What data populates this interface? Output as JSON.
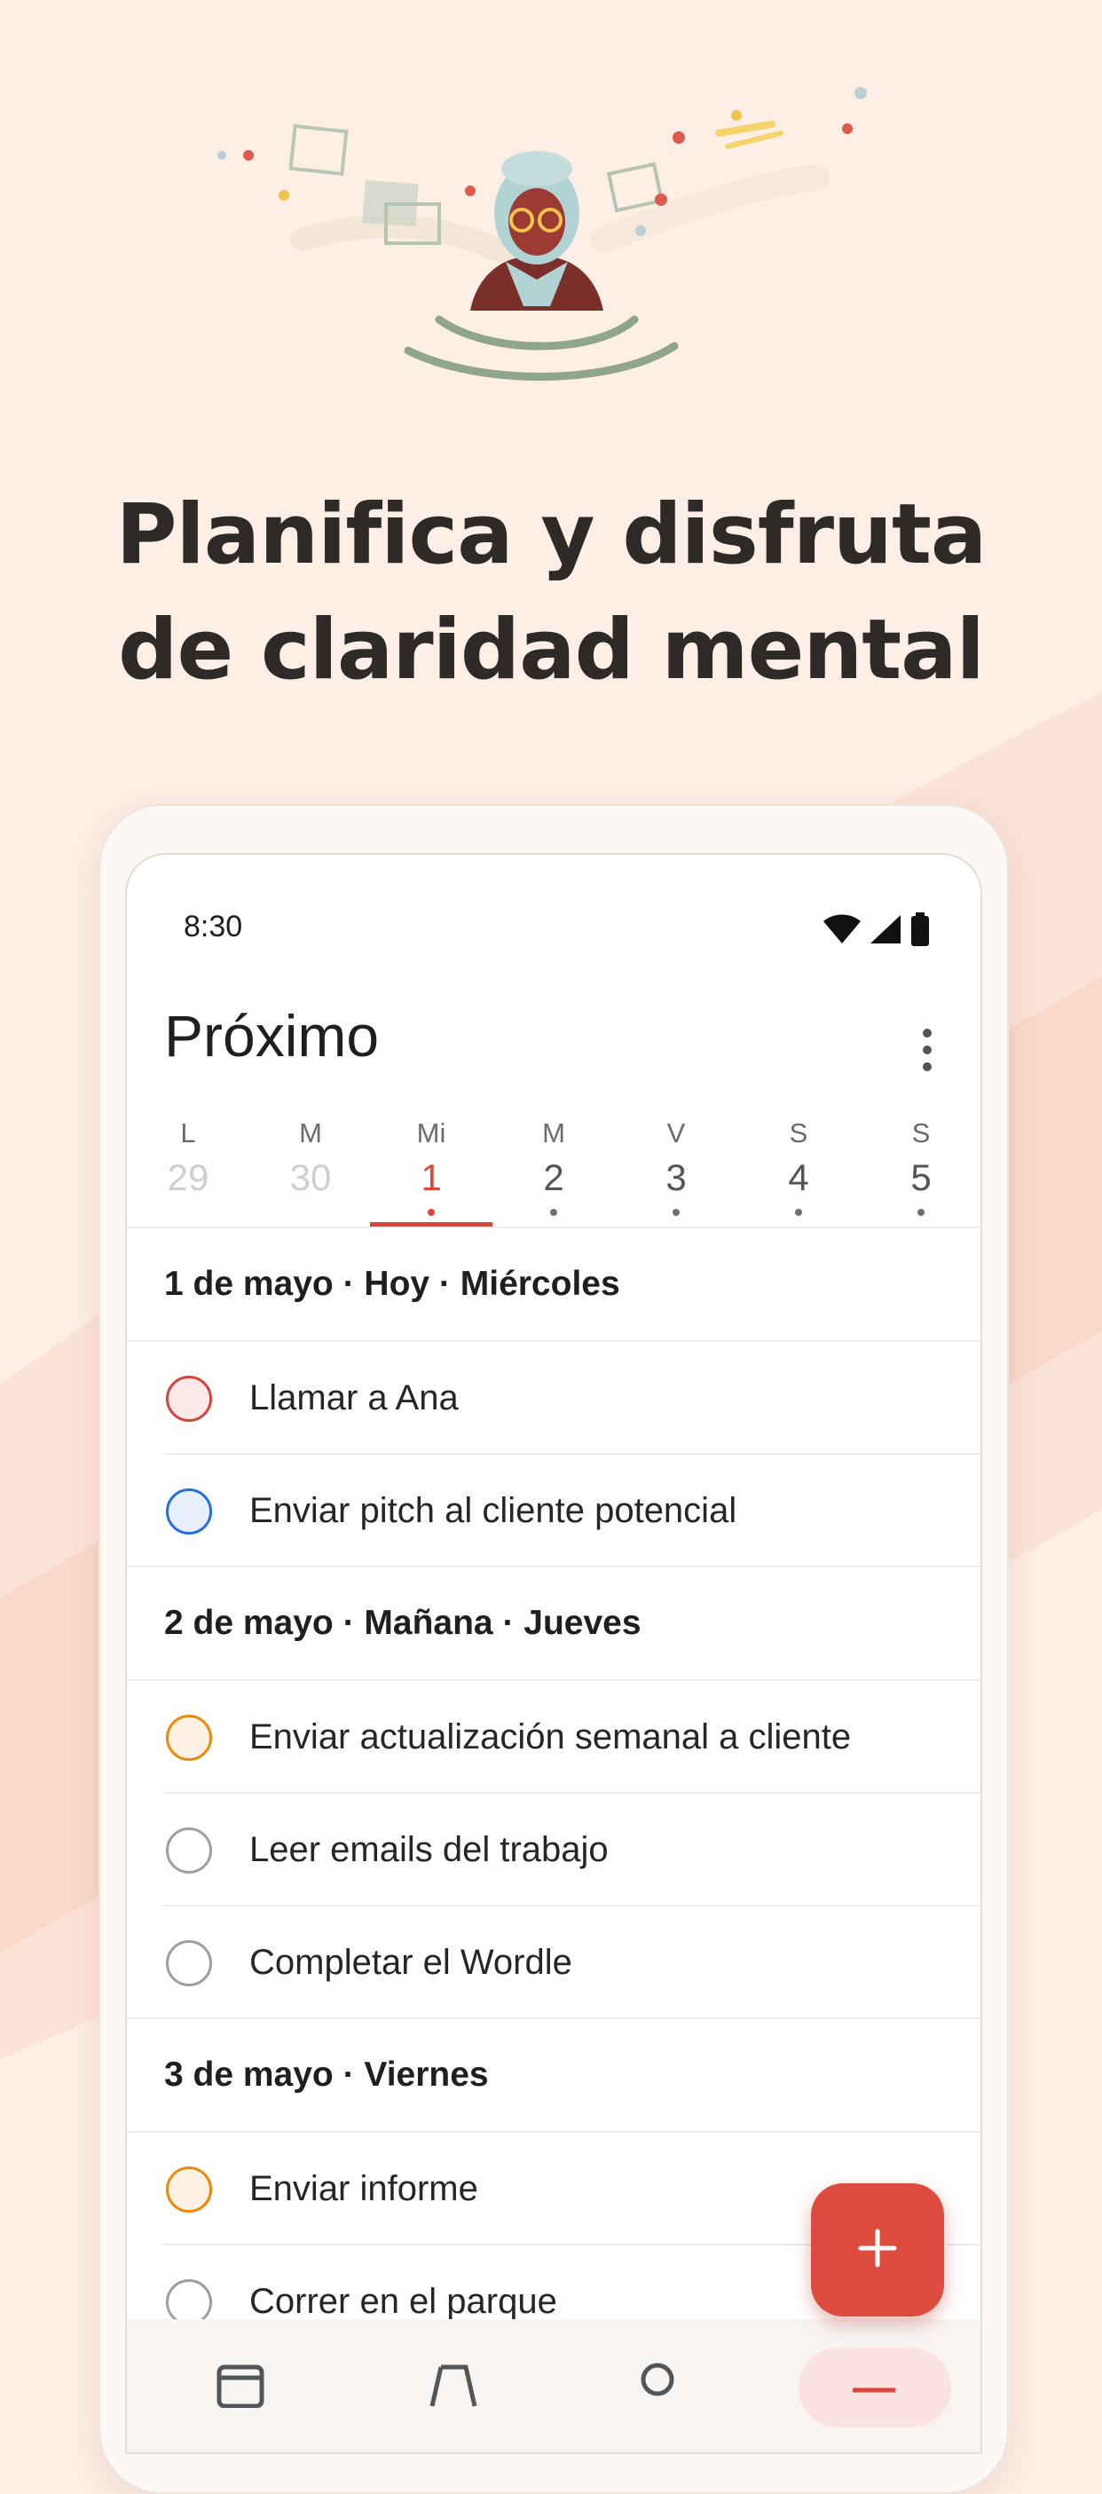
{
  "headline": {
    "line1": "Planifica y disfruta",
    "line2": "de claridad mental"
  },
  "status_bar": {
    "time": "8:30",
    "icons": [
      "wifi-icon",
      "signal-icon",
      "battery-icon"
    ]
  },
  "app": {
    "title": "Próximo",
    "menu_icon": "more-vert-icon"
  },
  "week": [
    {
      "letter": "L",
      "num": "29",
      "state": "past"
    },
    {
      "letter": "M",
      "num": "30",
      "state": "past"
    },
    {
      "letter": "Mi",
      "num": "1",
      "state": "active"
    },
    {
      "letter": "M",
      "num": "2",
      "state": "future"
    },
    {
      "letter": "V",
      "num": "3",
      "state": "future"
    },
    {
      "letter": "S",
      "num": "4",
      "state": "future"
    },
    {
      "letter": "S",
      "num": "5",
      "state": "future"
    }
  ],
  "sections": [
    {
      "header": "1 de mayo · Hoy · Miércoles",
      "tasks": [
        {
          "label": "Llamar a Ana",
          "priority_color": "#d1453b",
          "fill": "#fbe9e7"
        },
        {
          "label": "Enviar pitch al cliente potencial",
          "priority_color": "#246fe0",
          "fill": "#e8f0fc"
        }
      ]
    },
    {
      "header": "2 de mayo · Mañana · Jueves",
      "tasks": [
        {
          "label": "Enviar actualización semanal a cliente",
          "priority_color": "#eb8909",
          "fill": "#fdf1e3"
        },
        {
          "label": "Leer emails del trabajo",
          "priority_color": "#9e9e9e",
          "fill": "#ffffff"
        },
        {
          "label": "Completar el Wordle",
          "priority_color": "#9e9e9e",
          "fill": "#ffffff"
        }
      ]
    },
    {
      "header": "3 de mayo · Viernes",
      "tasks": [
        {
          "label": "Enviar informe",
          "priority_color": "#eb8909",
          "fill": "#fdf1e3"
        },
        {
          "label": "Correr en el parque",
          "priority_color": "#9e9e9e",
          "fill": "#ffffff"
        }
      ]
    }
  ],
  "fab": {
    "icon": "plus-icon"
  },
  "bottom_nav": {
    "items": [
      "calendar-icon",
      "filters-icon",
      "profile-icon",
      "menu-icon"
    ],
    "active_index": 3
  },
  "colors": {
    "accent": "#dd4b3e",
    "background": "#fdeee6",
    "headline": "#2d2a27"
  }
}
